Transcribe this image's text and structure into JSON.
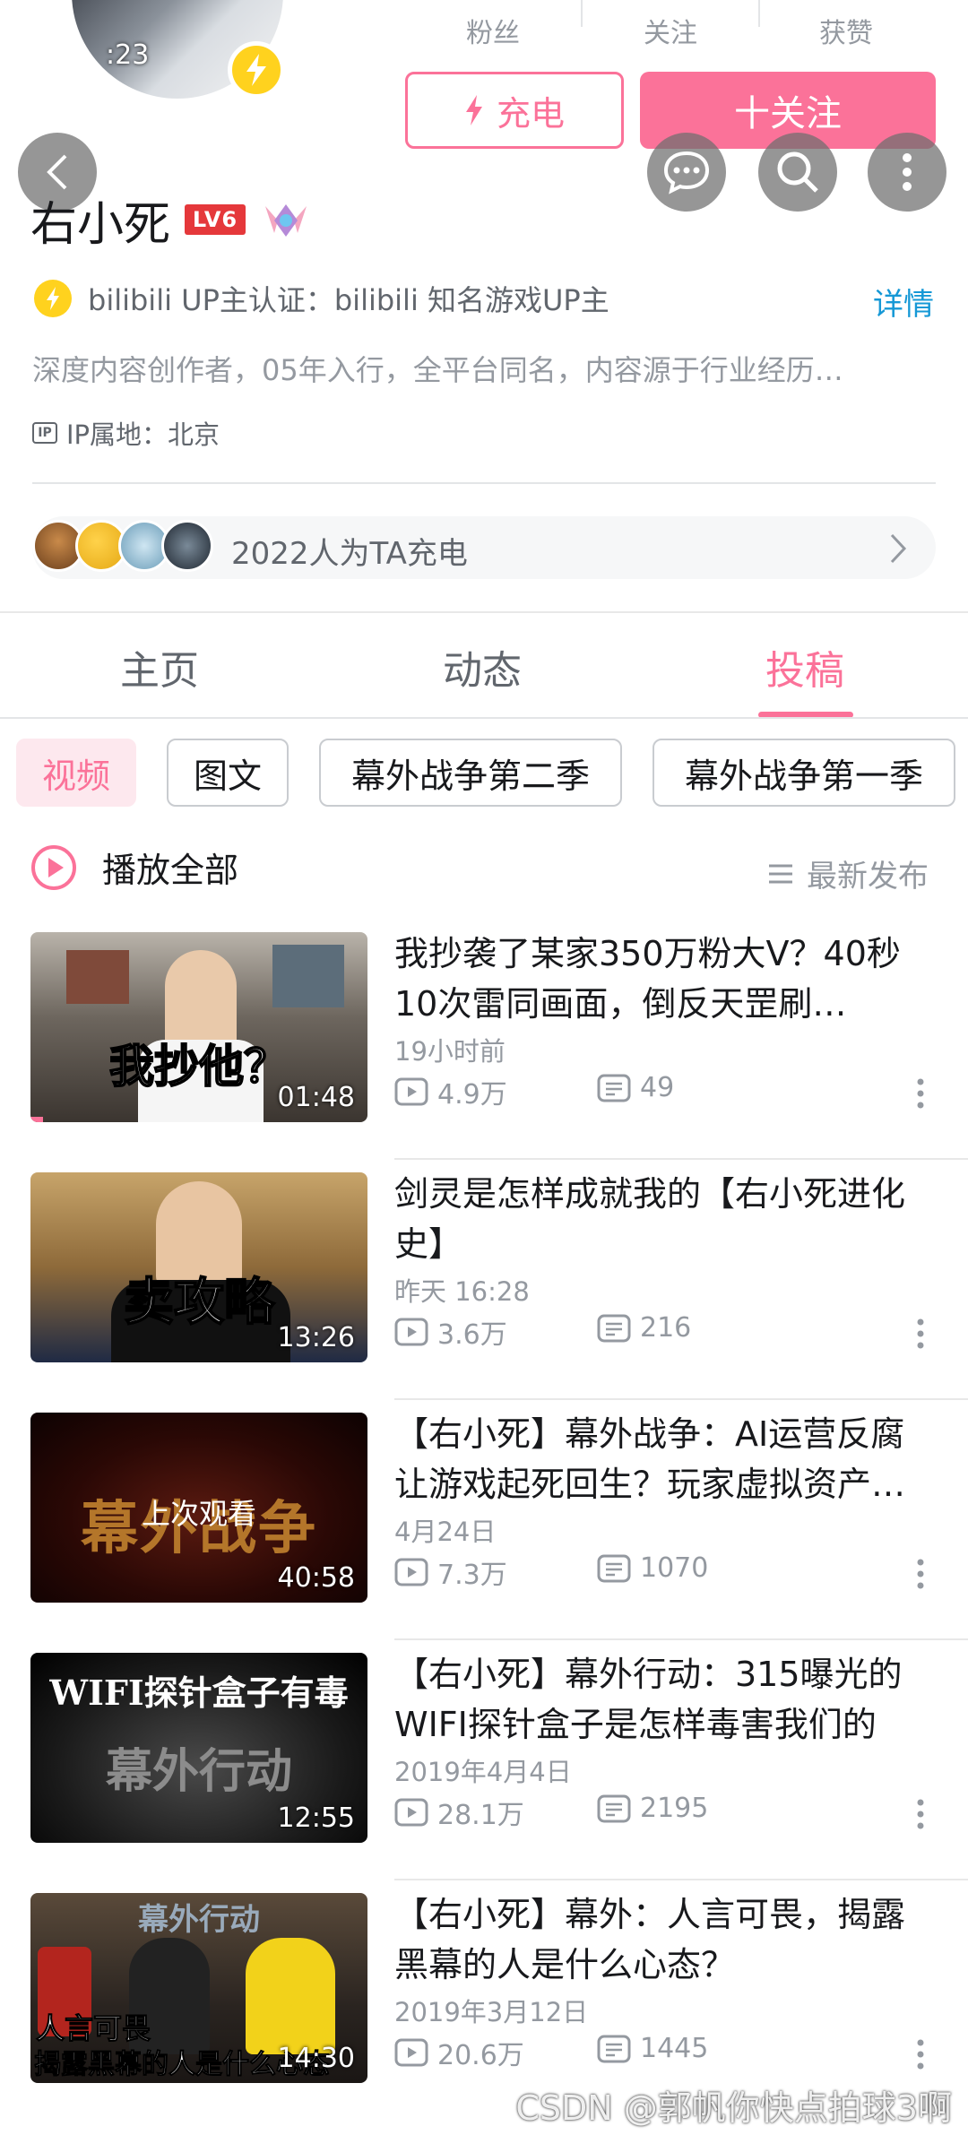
{
  "profile": {
    "avatar_time": ":23",
    "stats": [
      {
        "label": "粉丝"
      },
      {
        "label": "关注"
      },
      {
        "label": "获赞"
      }
    ],
    "charge_label": "充电",
    "follow_label": "十关注",
    "name": "右小死",
    "level": "LV6",
    "verify_text": "bilibili UP主认证：bilibili 知名游戏UP主",
    "detail_label": "详情",
    "intro": "深度内容创作者，05年入行，全平台同名，内容源于行业经历…",
    "ip": "IP属地：北京",
    "charge_count_text": "2022人为TA充电"
  },
  "tabs": [
    {
      "label": "主页"
    },
    {
      "label": "动态"
    },
    {
      "label": "投稿"
    }
  ],
  "chips": [
    {
      "label": "视频"
    },
    {
      "label": "图文"
    },
    {
      "label": "幕外战争第二季"
    },
    {
      "label": "幕外战争第一季"
    }
  ],
  "play_all_label": "播放全部",
  "sort_label": "最新发布",
  "videos": [
    {
      "thumb_text": "我抄他？",
      "duration": "01:48",
      "title": "我抄袭了某家350万粉大V？40秒10次雷同画面，倒反天罡刷…",
      "date": "19小时前",
      "views": "4.9万",
      "comments": "49"
    },
    {
      "thumb_text": "卖攻略",
      "duration": "13:26",
      "title": "剑灵是怎样成就我的【右小死进化史】",
      "date": "昨天 16:28",
      "views": "3.6万",
      "comments": "216"
    },
    {
      "thumb_text": "幕外战争",
      "overlay": "上次观看",
      "duration": "40:58",
      "title": "【右小死】幕外战争：AI运营反腐让游戏起死回生？玩家虚拟资产…",
      "date": "4月24日",
      "views": "7.3万",
      "comments": "1070"
    },
    {
      "thumb_text": "WIFI探针盒子有毒",
      "thumb_sub": "幕外行动",
      "duration": "12:55",
      "title": "【右小死】幕外行动：315曝光的WIFI探针盒子是怎样毒害我们的",
      "date": "2019年4月4日",
      "views": "28.1万",
      "comments": "2195"
    },
    {
      "thumb_text": "人言可畏",
      "thumb_sub": "揭露黑幕的人是什么心态",
      "thumb_top": "幕外行动",
      "duration": "14:30",
      "title": "【右小死】幕外：人言可畏，揭露黑幕的人是什么心态？",
      "date": "2019年3月12日",
      "views": "20.6万",
      "comments": "1445"
    }
  ],
  "watermark": "CSDN @郭帆你快点拍球3啊"
}
